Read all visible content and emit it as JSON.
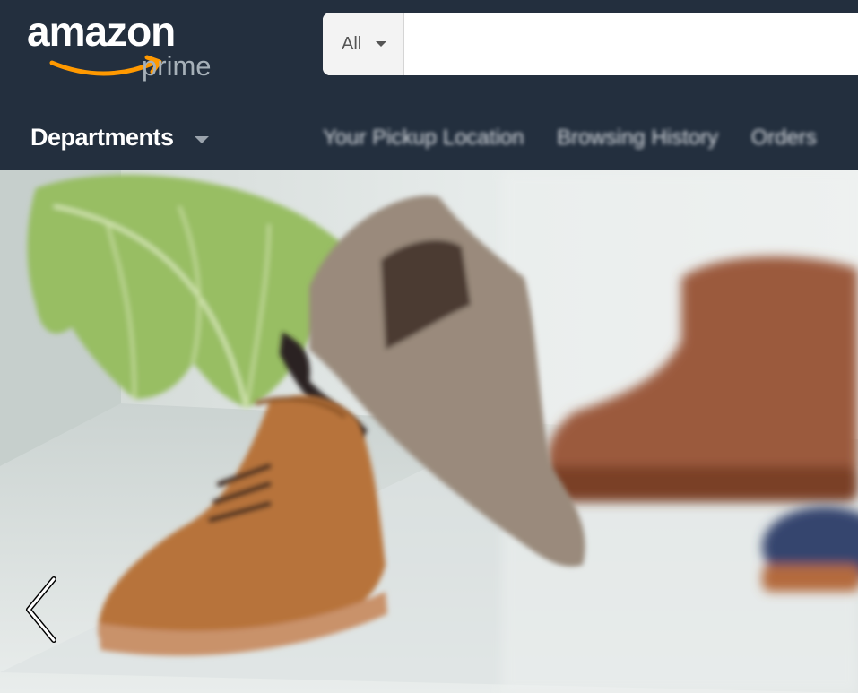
{
  "header": {
    "logo": {
      "brand": "amazon",
      "sub": "prime"
    },
    "search": {
      "category": "All",
      "placeholder": "",
      "value": ""
    }
  },
  "nav": {
    "departments_label": "Departments",
    "links": [
      "Your Pickup Location",
      "Browsing History",
      "Orders"
    ]
  },
  "hero": {
    "image_subject": "boots-display"
  },
  "colors": {
    "header_bg": "#232f3e",
    "smile": "#ff9900",
    "prime_text": "#a6b0b8"
  },
  "icons": [
    "caret-down-icon",
    "chevron-left-icon",
    "amazon-smile-icon"
  ]
}
